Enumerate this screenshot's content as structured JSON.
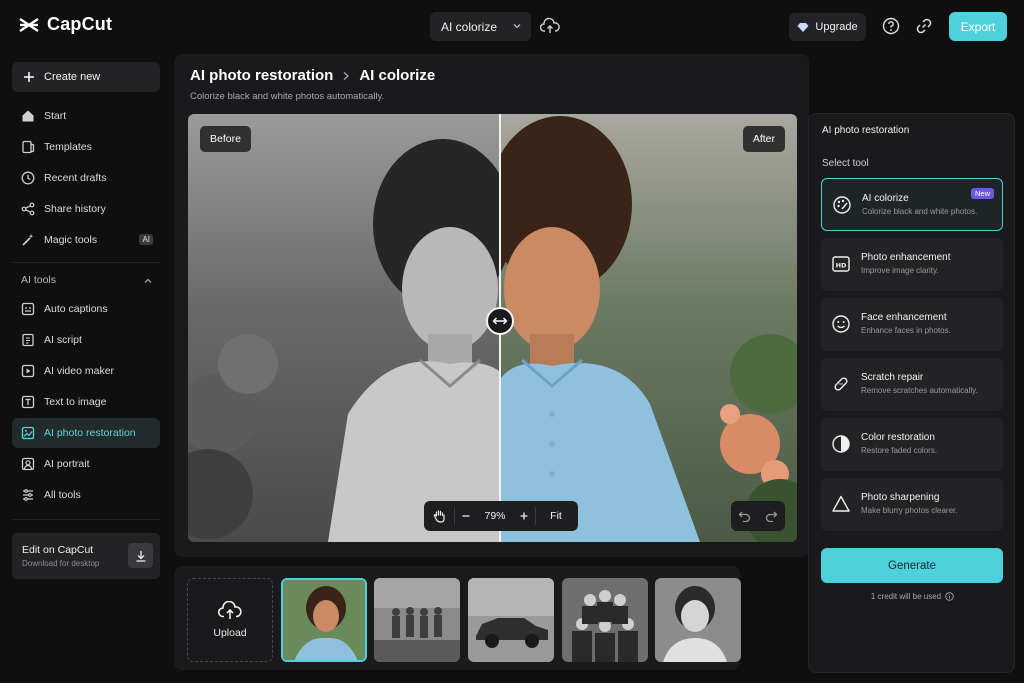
{
  "app": {
    "name": "CapCut"
  },
  "topbar": {
    "tool_select_label": "AI colorize",
    "upgrade_label": "Upgrade",
    "export_label": "Export"
  },
  "sidebar": {
    "create_label": "Create new",
    "items": [
      {
        "label": "Start",
        "icon": "home-icon"
      },
      {
        "label": "Templates",
        "icon": "templates-icon"
      },
      {
        "label": "Recent drafts",
        "icon": "clock-icon"
      },
      {
        "label": "Share history",
        "icon": "share-icon"
      },
      {
        "label": "Magic tools",
        "icon": "magic-wand-icon",
        "badge": "AI"
      }
    ],
    "ai_tools_title": "AI tools",
    "ai_tools": [
      {
        "label": "Auto captions",
        "icon": "captions-icon"
      },
      {
        "label": "AI script",
        "icon": "script-icon"
      },
      {
        "label": "AI video maker",
        "icon": "video-maker-icon"
      },
      {
        "label": "Text to image",
        "icon": "text-image-icon"
      },
      {
        "label": "AI photo restoration",
        "icon": "photo-restoration-icon",
        "active": true
      },
      {
        "label": "AI portrait",
        "icon": "portrait-icon"
      },
      {
        "label": "All tools",
        "icon": "all-tools-icon"
      }
    ],
    "edit_card": {
      "title": "Edit on CapCut",
      "subtitle": "Download for desktop"
    }
  },
  "main": {
    "breadcrumb_parent": "AI photo restoration",
    "breadcrumb_current": "AI colorize",
    "subtitle": "Colorize black and white photos automatically.",
    "before_label": "Before",
    "after_label": "After",
    "zoom_value": "79%",
    "fit_label": "Fit"
  },
  "thumbs": {
    "upload_label": "Upload"
  },
  "right_panel": {
    "title": "AI photo restoration",
    "select_title": "Select tool",
    "tools": [
      {
        "name": "AI colorize",
        "desc": "Colorize black and white photos.",
        "icon": "palette-icon",
        "badge": "New",
        "active": true
      },
      {
        "name": "Photo enhancement",
        "desc": "Improve image clarity.",
        "icon": "hd-icon"
      },
      {
        "name": "Face enhancement",
        "desc": "Enhance faces in photos.",
        "icon": "smile-icon"
      },
      {
        "name": "Scratch repair",
        "desc": "Remove scratches automatically.",
        "icon": "bandage-icon"
      },
      {
        "name": "Color restoration",
        "desc": "Restore faded colors.",
        "icon": "color-circle-icon"
      },
      {
        "name": "Photo sharpening",
        "desc": "Make blurry photos clearer.",
        "icon": "triangle-icon"
      }
    ],
    "generate_label": "Generate",
    "credit_text": "1 credit will be used"
  },
  "colors": {
    "accent": "#4fd1dc",
    "new_badge": "#6b5ae0",
    "bg": "#0f0f10",
    "panel": "#1a1a1c"
  }
}
